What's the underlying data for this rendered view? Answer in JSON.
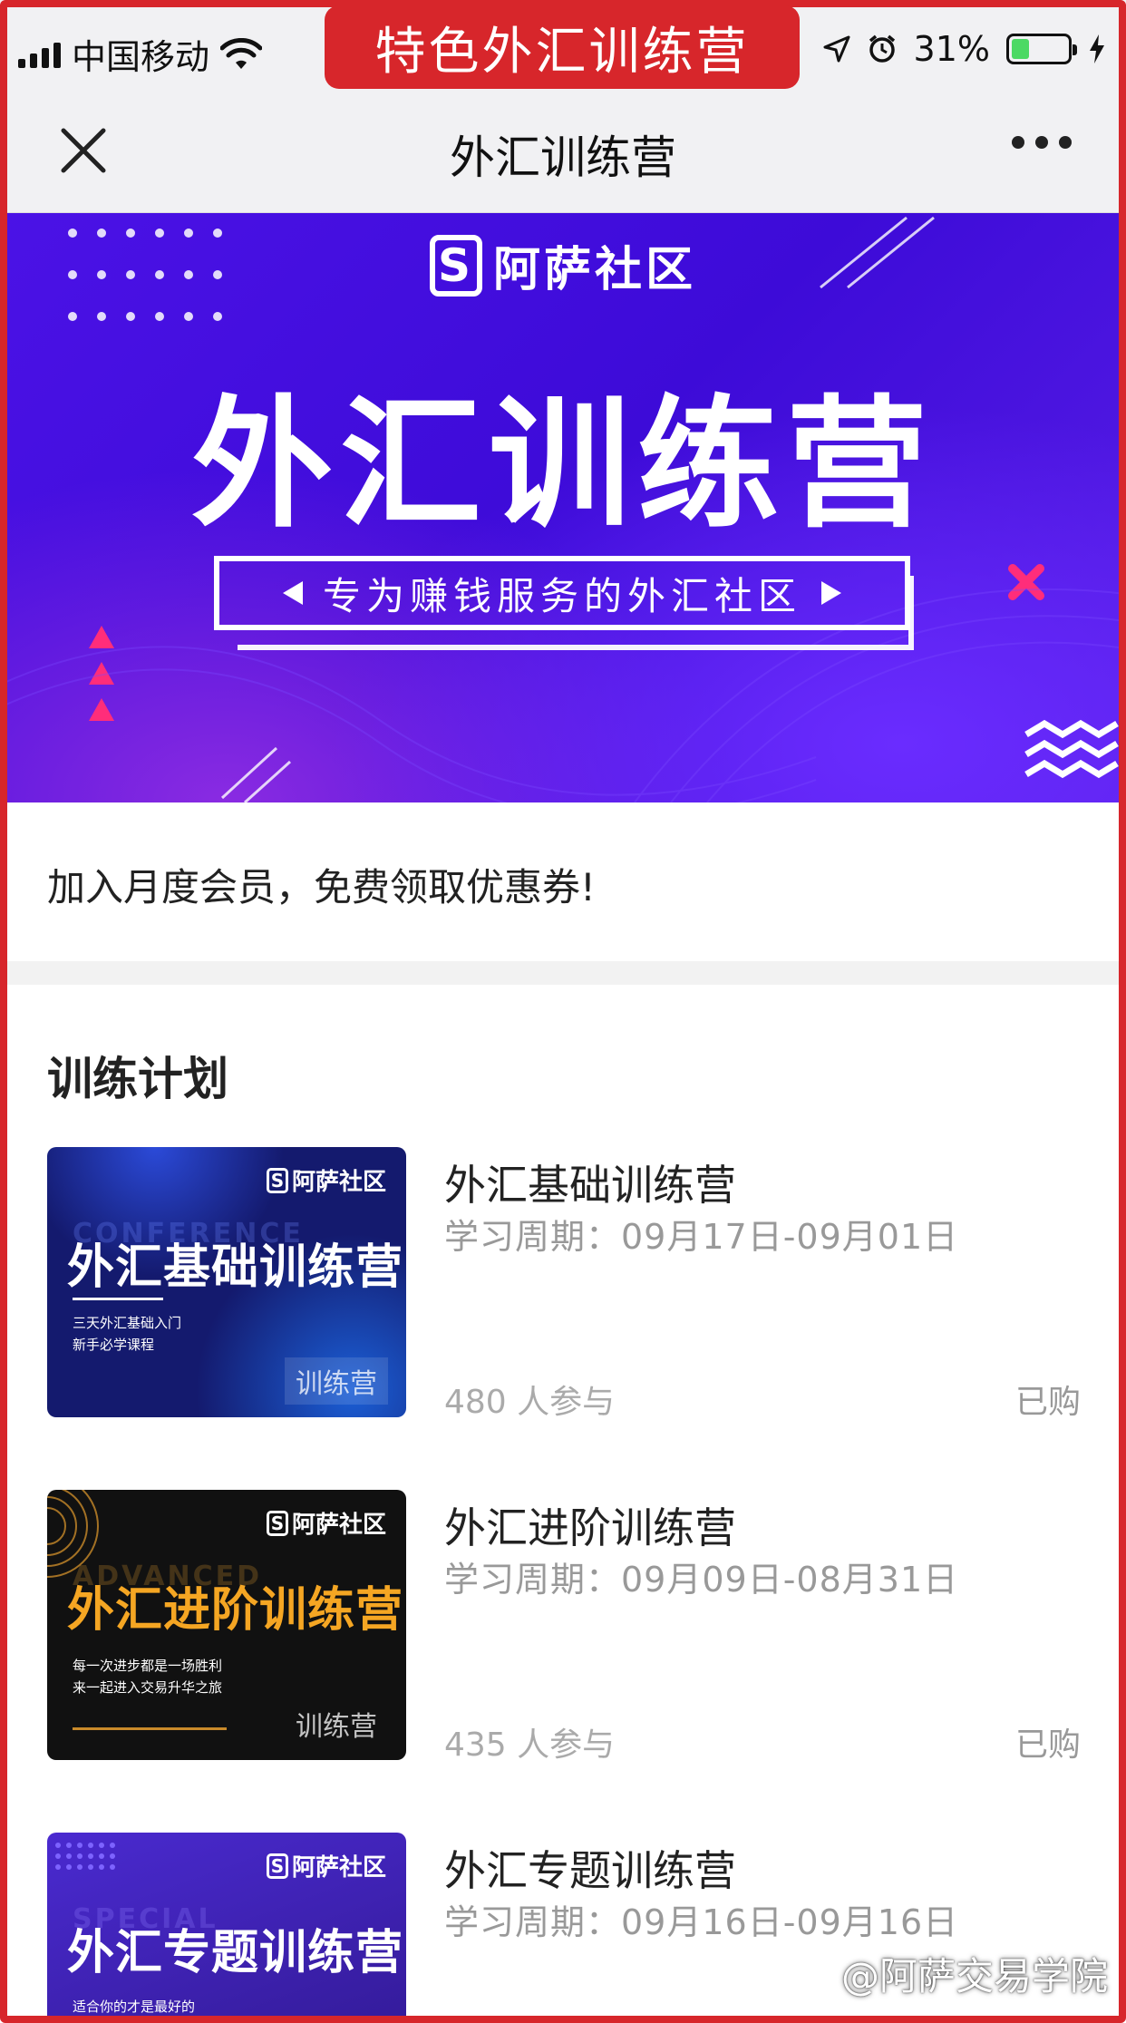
{
  "overlay_label": "特色外汇训练营",
  "status_bar": {
    "carrier": "中国移动",
    "battery": "31%",
    "battery_level": 0.31
  },
  "nav": {
    "title": "外汇训练营"
  },
  "banner": {
    "brand": "阿萨社区",
    "brand_icon_letter": "S",
    "title": "外汇训练营",
    "subtitle": "专为赚钱服务的外汇社区"
  },
  "promo": {
    "text": "加入月度会员，免费领取优惠券!"
  },
  "section": {
    "title": "训练计划"
  },
  "courses": [
    {
      "title": "外汇基础训练营",
      "period": "学习周期：09月17日-09月01日",
      "count": "480 人参与",
      "status": "已购",
      "thumb": {
        "brand": "阿萨社区",
        "ghost": "CONFERENCE",
        "title": "外汇基础训练营",
        "desc1": "三天外汇基础入门",
        "desc2": "新手必学课程",
        "tag": "训练营",
        "bg": "#141a6e",
        "title_color": "#ffffff"
      }
    },
    {
      "title": "外汇进阶训练营",
      "period": "学习周期：09月09日-08月31日",
      "count": "435 人参与",
      "status": "已购",
      "thumb": {
        "brand": "阿萨社区",
        "ghost": "ADVANCED",
        "title": "外汇进阶训练营",
        "desc1": "每一次进步都是一场胜利",
        "desc2": "来一起进入交易升华之旅",
        "tag": "训练营",
        "bg": "#111111",
        "title_color": "#f5a623"
      }
    },
    {
      "title": "外汇专题训练营",
      "period": "学习周期：09月16日-09月16日",
      "thumb": {
        "brand": "阿萨社区",
        "ghost": "SPECIAL",
        "title": "外汇专题训练营",
        "desc1": "适合你的才是最好的",
        "bg": "#3a1fa8",
        "title_color": "#ffffff"
      }
    }
  ],
  "watermark": "@阿萨交易学院",
  "colors": {
    "frame": "#d7262b",
    "banner": "#4b12e6",
    "accent_pink": "#ff2d7a"
  }
}
